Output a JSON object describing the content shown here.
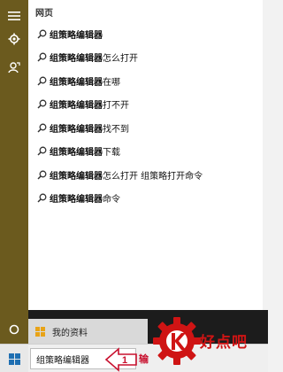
{
  "search_panel": {
    "section_title": "网页",
    "results": [
      {
        "bold": "组策略编辑器",
        "rest": ""
      },
      {
        "bold": "组策略编辑器",
        "rest": "怎么打开"
      },
      {
        "bold": "组策略编辑器",
        "rest": "在哪"
      },
      {
        "bold": "组策略编辑器",
        "rest": "打不开"
      },
      {
        "bold": "组策略编辑器",
        "rest": "找不到"
      },
      {
        "bold": "组策略编辑器",
        "rest": "下载"
      },
      {
        "bold": "组策略编辑器",
        "rest": "怎么打开 组策略打开命令"
      },
      {
        "bold": "组策略编辑器",
        "rest": "命令"
      }
    ]
  },
  "apps_row": {
    "label": "我的资料"
  },
  "taskbar": {
    "search_value": "组策略编辑器"
  },
  "annotation": {
    "step_number": "1",
    "text": "输"
  },
  "watermark": {
    "text": "好点吧"
  },
  "colors": {
    "rail": "#6b5a1e",
    "panel": "#ffffff",
    "accent_red": "#c8102e"
  }
}
